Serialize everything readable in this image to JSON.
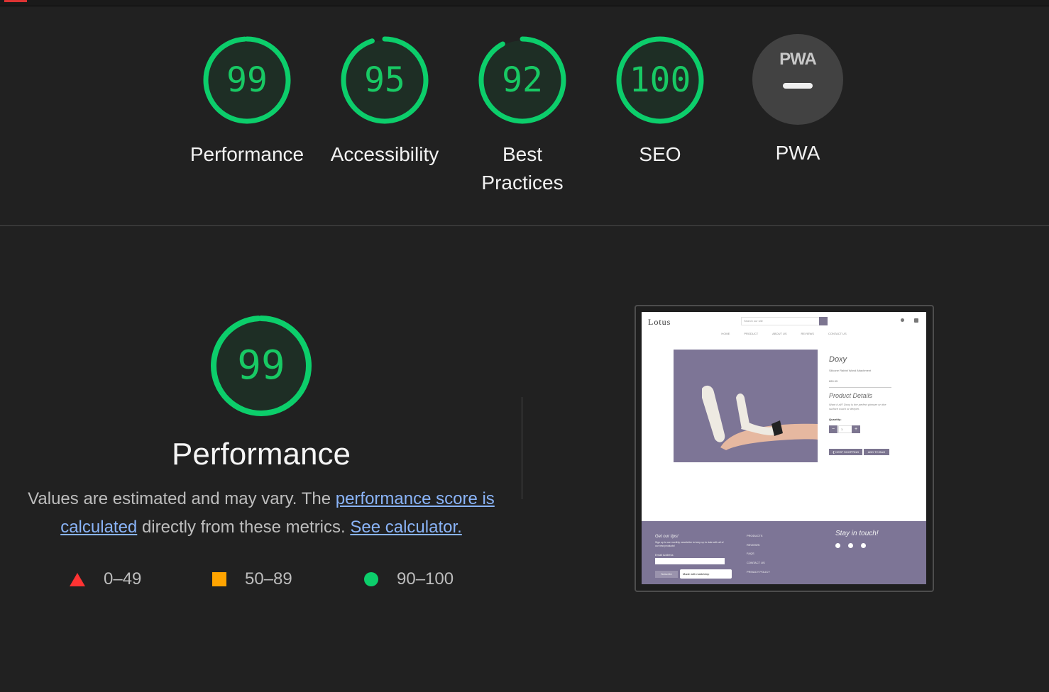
{
  "categories": [
    {
      "id": "performance",
      "score": "99",
      "fraction": 0.99,
      "label": "Performance",
      "color": "#0cce6b"
    },
    {
      "id": "accessibility",
      "score": "95",
      "fraction": 0.95,
      "label": "Accessibility",
      "color": "#0cce6b"
    },
    {
      "id": "best-practices",
      "score": "92",
      "fraction": 0.92,
      "label_line1": "Best",
      "label_line2": "Practices",
      "color": "#0cce6b"
    },
    {
      "id": "seo",
      "score": "100",
      "fraction": 1.0,
      "label": "SEO",
      "color": "#0cce6b"
    }
  ],
  "pwa": {
    "mark": "PWA",
    "label": "PWA"
  },
  "performance_section": {
    "score": "99",
    "fraction": 0.99,
    "title": "Performance",
    "desc_prefix": "Values are estimated and may vary. The ",
    "link_score": "performance score is calculated",
    "desc_middle": " directly from these metrics. ",
    "link_calc": "See calculator."
  },
  "legend": [
    {
      "shape": "triangle",
      "color": "#ff3333",
      "range": "0–49"
    },
    {
      "shape": "square",
      "color": "#ffa400",
      "range": "50–89"
    },
    {
      "shape": "circle",
      "color": "#0cce6b",
      "range": "90–100"
    }
  ],
  "screenshot": {
    "logo": "Lotus",
    "search_placeholder": "Search our site",
    "nav": [
      "HOME",
      "PRODUCT",
      "ABOUT US",
      "REVIEWS",
      "CONTACT US"
    ],
    "product_title": "Doxy",
    "product_subtitle": "Silicone Rabbit Wand Attachment",
    "price": "€80.95",
    "details_heading": "Product Details",
    "details_text": "Want it all? Doxy is the perfect pleaser on the surface touch or deeper.",
    "quantity_label": "Quantity:",
    "quantity_value": "1",
    "minus": "−",
    "plus": "+",
    "keep_shopping": "❮ KEEP SHOPPING",
    "add_to_bag": "ADD TO BAG",
    "footer": {
      "tips_title": "Get our tips!",
      "tips_desc": "Sign up to our monthly newsletter to keep up to date with all of our new products!",
      "email_label": "Email Address",
      "subscribe": "Subscribe",
      "mailchimp": "Made with mailchimp",
      "links": [
        "PRODUCTS",
        "REVIEWS",
        "FAQS",
        "CONTACT US",
        "PRIVACY POLICY"
      ],
      "touch_title": "Stay in touch!",
      "social_icons": [
        "facebook-icon",
        "instagram-icon",
        "youtube-icon"
      ]
    }
  }
}
